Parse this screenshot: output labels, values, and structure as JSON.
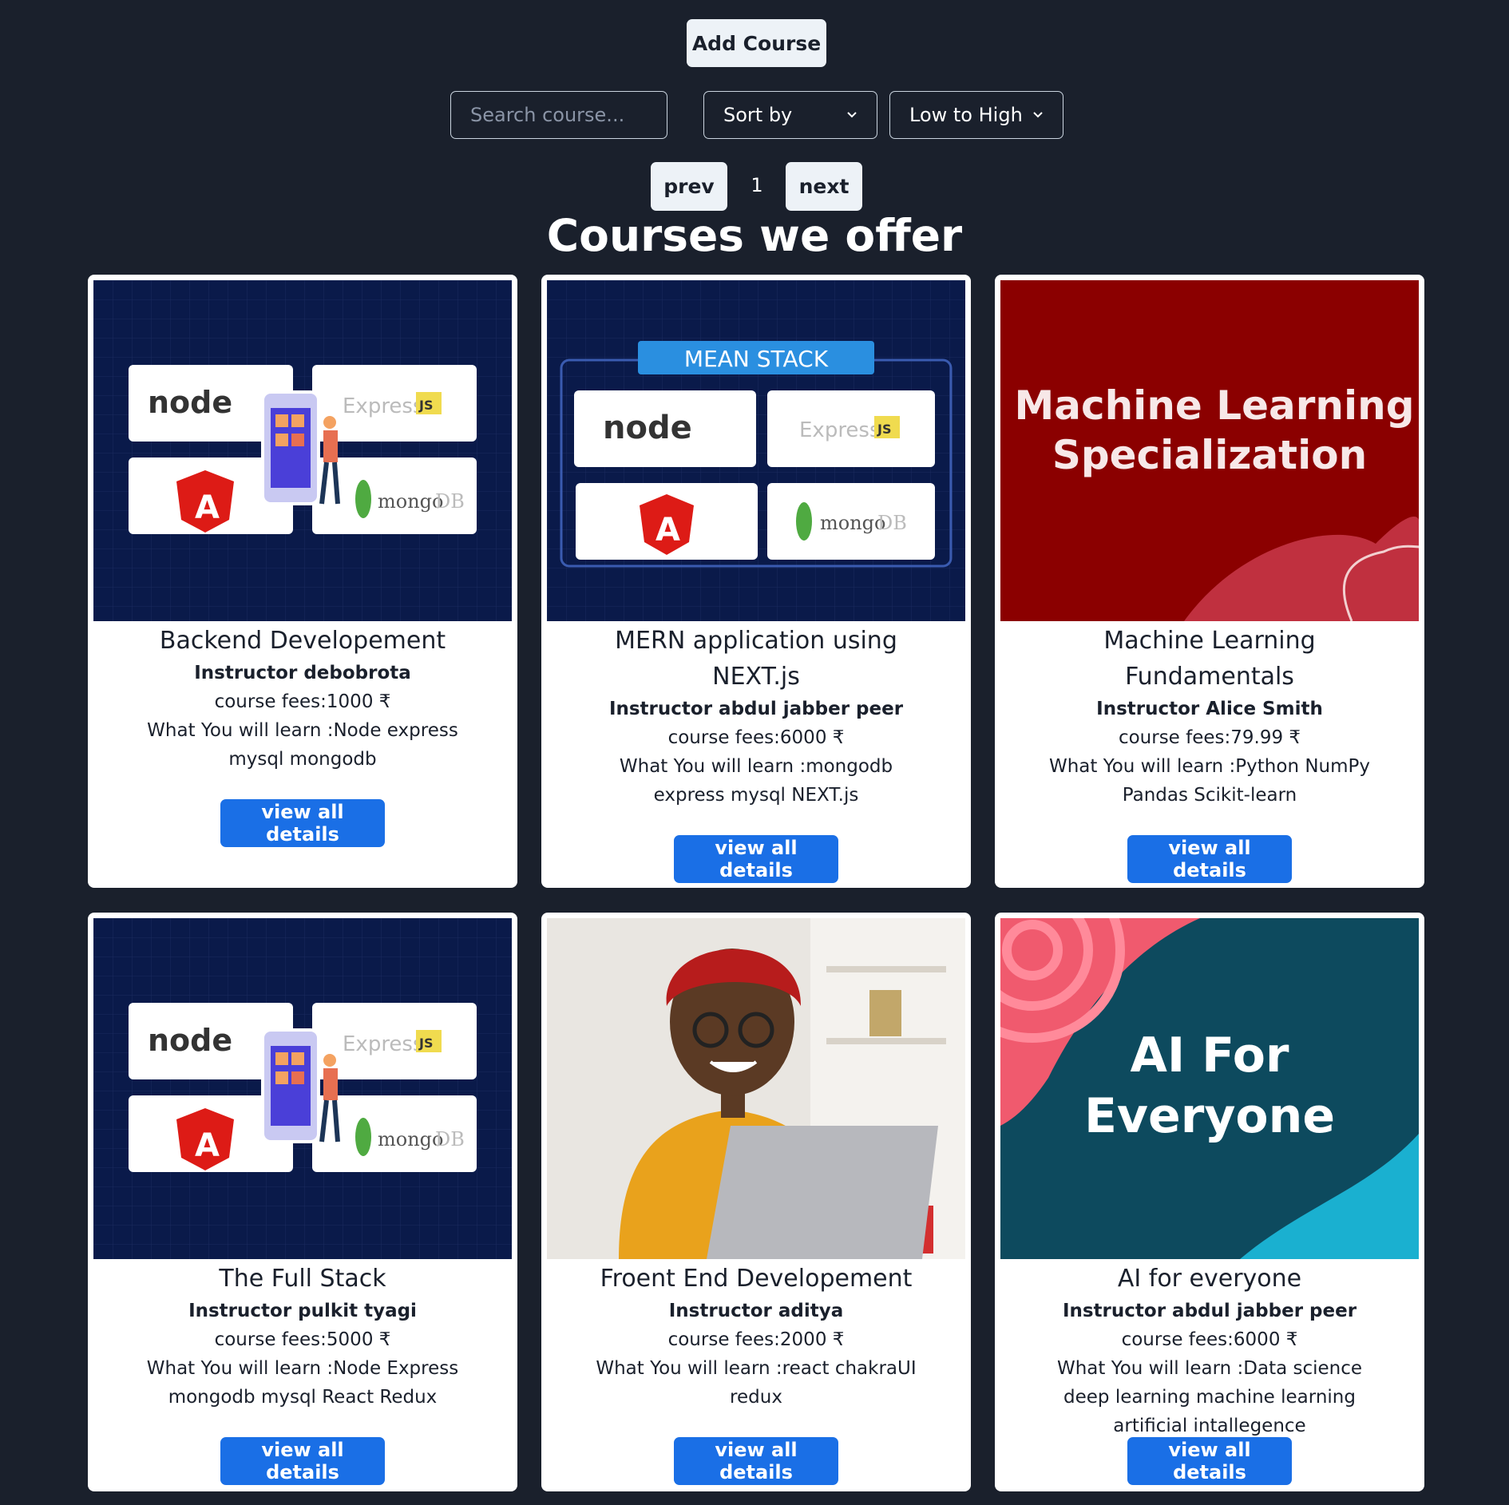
{
  "toolbar": {
    "add_course_label": "Add Course",
    "search_placeholder": "Search course...",
    "sort_label": "Sort by",
    "order_label": "Low to High"
  },
  "pagination": {
    "prev_label": "prev",
    "page": "1",
    "next_label": "next"
  },
  "heading": "Courses we offer",
  "view_label": "view all details",
  "colors": {
    "background": "#1a202c",
    "button_blue": "#1a6fe6"
  },
  "images": {
    "mean_banner": "MEAN STACK",
    "ml_line1": "Machine Learning",
    "ml_line2": "Specialization",
    "ai_line1": "AI For",
    "ai_line2": "Everyone",
    "node": "node",
    "express": "Express",
    "js": "JS",
    "angular": "A",
    "mongo": "mongo",
    "db": "DB"
  },
  "courses": [
    {
      "title": "Backend Developement",
      "instructor": "Instructor debobrota",
      "fee": "course fees:1000 ₹",
      "learn": "What You will learn :Node express mysql mongodb",
      "image": "stack-graphic"
    },
    {
      "title": "MERN application using NEXT.js",
      "instructor": "Instructor abdul jabber peer",
      "fee": "course fees:6000 ₹",
      "learn": "What You will learn :mongodb express mysql NEXT.js",
      "image": "mean-stack-graphic"
    },
    {
      "title": "Machine Learning Fundamentals",
      "instructor": "Instructor Alice Smith",
      "fee": "course fees:79.99 ₹",
      "learn": "What You will learn :Python NumPy Pandas Scikit-learn",
      "image": "ml-graphic"
    },
    {
      "title": "The Full Stack",
      "instructor": "Instructor pulkit tyagi",
      "fee": "course fees:5000 ₹",
      "learn": "What You will learn :Node Express mongodb mysql React Redux",
      "image": "stack-graphic"
    },
    {
      "title": "Froent End Developement",
      "instructor": "Instructor aditya",
      "fee": "course fees:2000 ₹",
      "learn": "What You will learn :react chakraUI redux",
      "image": "photo-woman-laptop"
    },
    {
      "title": "AI for everyone",
      "instructor": "Instructor abdul jabber peer",
      "fee": "course fees:6000 ₹",
      "learn": "What You will learn :Data science deep learning machine learning artificial intallegence",
      "image": "ai-graphic"
    }
  ]
}
